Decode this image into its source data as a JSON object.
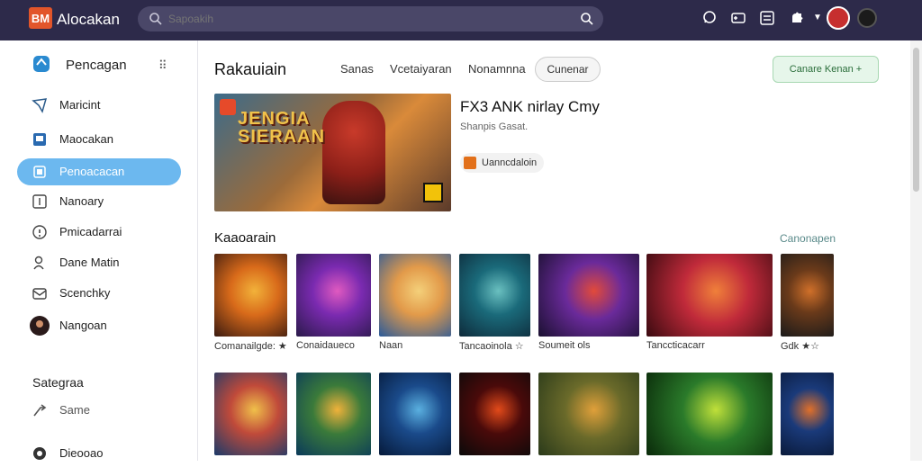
{
  "app": {
    "logo_text": "BM",
    "title": "Alocakan"
  },
  "search": {
    "placeholder": "Sapoakih"
  },
  "sidebar": {
    "header_label": "Pencagan",
    "items": [
      {
        "label": "Maricint",
        "icon": "compass-icon"
      },
      {
        "label": "Maocakan",
        "icon": "book-icon"
      },
      {
        "label": "Penoacacan",
        "icon": "gamepad-icon",
        "active": true
      },
      {
        "label": "Nanoary",
        "icon": "list-icon"
      },
      {
        "label": "Pmicadarrai",
        "icon": "info-icon"
      },
      {
        "label": "Dane Matin",
        "icon": "user-icon"
      },
      {
        "label": "Scenchky",
        "icon": "mail-icon"
      },
      {
        "label": "Nangoan",
        "icon": "avatar"
      }
    ],
    "section_title": "Sategraa",
    "section_items": [
      {
        "label": "Same",
        "icon": "share-icon"
      },
      {
        "label": "Dieooao",
        "icon": "dot-icon"
      }
    ]
  },
  "main": {
    "page_title": "Rakauiain",
    "tabs": [
      "Sanas",
      "Vcetaiyaran",
      "Nonamnna"
    ],
    "tab_pill": "Cunenar",
    "add_button": "Canare Kenan +",
    "featured": {
      "hero_title": "JENGIA SIERAAN",
      "title": "FX3 ANK nirlay Cmy",
      "subtitle": "Shanpis Gasat.",
      "developer": "Uanncdaloin"
    },
    "section_title": "Kaaoarain",
    "section_link": "Canonapen",
    "row1": [
      {
        "caption": "Comanailgde: ★",
        "colors": [
          "#3a1a10",
          "#d86a1a",
          "#f2b23a"
        ]
      },
      {
        "caption": "Conaidaueco",
        "colors": [
          "#2a1a4a",
          "#7a2ab0",
          "#e05ac0"
        ]
      },
      {
        "caption": "Naan",
        "colors": [
          "#2a5a9a",
          "#e29a4a",
          "#f4d07a"
        ]
      },
      {
        "caption": "Tancaoinola ☆",
        "colors": [
          "#0e2a3a",
          "#1a6a7a",
          "#6ac0c0"
        ]
      },
      {
        "caption": "Soumeit ols",
        "colors": [
          "#1a1030",
          "#6a2a9a",
          "#e24a3a"
        ]
      },
      {
        "caption": "Tanccticacarr",
        "colors": [
          "#3a0a10",
          "#c02a3a",
          "#f0803a"
        ]
      },
      {
        "caption": "Gdk  ★☆",
        "colors": [
          "#1a1a1a",
          "#6a3a1a",
          "#d0702a"
        ]
      }
    ],
    "row2": [
      {
        "caption": "",
        "colors": [
          "#1a3a6a",
          "#c04a3a",
          "#f0c04a"
        ]
      },
      {
        "caption": "",
        "colors": [
          "#0a3a5a",
          "#3a7a3a",
          "#f0b23a"
        ]
      },
      {
        "caption": "",
        "colors": [
          "#061a3a",
          "#1a4a8a",
          "#5ab0e0"
        ]
      },
      {
        "caption": "",
        "colors": [
          "#0a0a0a",
          "#4a0a0a",
          "#e24a1a"
        ]
      },
      {
        "caption": "",
        "colors": [
          "#2a3a1a",
          "#6a6a2a",
          "#e0a03a"
        ]
      },
      {
        "caption": "",
        "colors": [
          "#0a2a0a",
          "#2a7a2a",
          "#c0e03a"
        ]
      },
      {
        "caption": "",
        "colors": [
          "#0a1a3a",
          "#1a3a7a",
          "#e0702a"
        ]
      }
    ]
  },
  "colors": {
    "topbar": "#2d2a4a",
    "accent": "#6cb8ef",
    "logo": "#e2552a"
  }
}
